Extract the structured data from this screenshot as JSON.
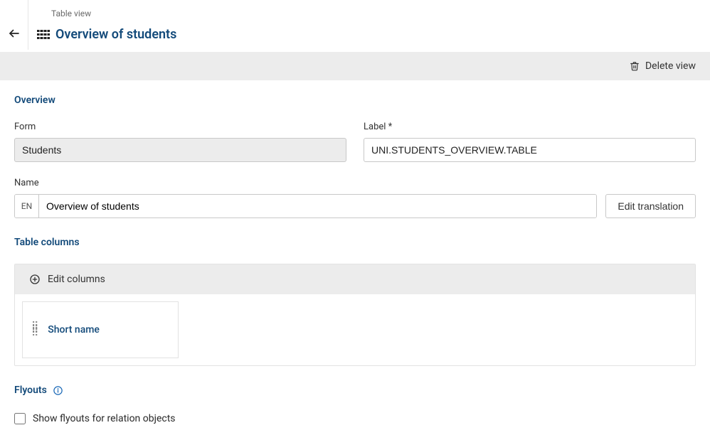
{
  "breadcrumb": "Table view",
  "page_title": "Overview of students",
  "toolbar": {
    "delete_label": "Delete view"
  },
  "sections": {
    "overview": {
      "heading": "Overview",
      "form_label": "Form",
      "form_value": "Students",
      "label_label": "Label",
      "label_value": "UNI.STUDENTS_OVERVIEW.TABLE",
      "name_label": "Name",
      "name_lang": "EN",
      "name_value": "Overview of students",
      "edit_translation_label": "Edit translation"
    },
    "table_columns": {
      "heading": "Table columns",
      "edit_columns_label": "Edit columns",
      "columns": [
        {
          "label": "Short name"
        }
      ]
    },
    "flyouts": {
      "heading": "Flyouts",
      "checkbox_label": "Show flyouts for relation objects",
      "checkbox_checked": false
    }
  }
}
